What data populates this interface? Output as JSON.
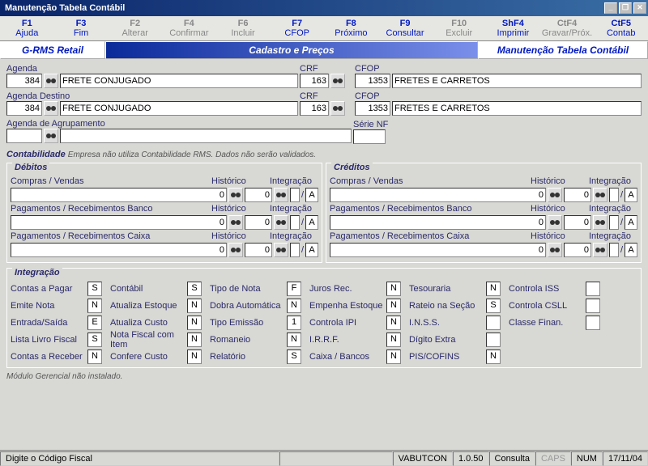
{
  "window": {
    "title": "Manutenção Tabela Contábil"
  },
  "fkeys": [
    {
      "top": "F1",
      "bot": "Ajuda",
      "disabled": false
    },
    {
      "top": "F3",
      "bot": "Fim",
      "disabled": false
    },
    {
      "top": "F2",
      "bot": "Alterar",
      "disabled": true
    },
    {
      "top": "F4",
      "bot": "Confirmar",
      "disabled": true
    },
    {
      "top": "F6",
      "bot": "Incluir",
      "disabled": true
    },
    {
      "top": "F7",
      "bot": "CFOP",
      "disabled": false
    },
    {
      "top": "F8",
      "bot": "Próximo",
      "disabled": false
    },
    {
      "top": "F9",
      "bot": "Consultar",
      "disabled": false
    },
    {
      "top": "F10",
      "bot": "Excluir",
      "disabled": true
    },
    {
      "top": "ShF4",
      "bot": "Imprimir",
      "disabled": false
    },
    {
      "top": "CtF4",
      "bot": "Gravar/Próx.",
      "disabled": true
    },
    {
      "top": "CtF5",
      "bot": "Contab",
      "disabled": false
    }
  ],
  "modebar": {
    "seg1": "G-RMS Retail",
    "seg2": "Cadastro e Preços",
    "seg3": "Manutenção Tabela Contábil"
  },
  "agenda": {
    "label": "Agenda",
    "code": "384",
    "desc": "FRETE CONJUGADO",
    "crf_label": "CRF",
    "crf": "163",
    "cfop_label": "CFOP",
    "cfop": "1353",
    "cfop_desc": "FRETES E CARRETOS"
  },
  "agenda_dest": {
    "label": "Agenda Destino",
    "code": "384",
    "desc": "FRETE CONJUGADO",
    "crf_label": "CRF",
    "crf": "163",
    "cfop_label": "CFOP",
    "cfop": "1353",
    "cfop_desc": "FRETES E CARRETOS"
  },
  "agrup": {
    "label": "Agenda de Agrupamento",
    "code": "",
    "desc": "",
    "serie_label": "Série NF",
    "serie": ""
  },
  "contabilidade": {
    "title": "Contabilidade",
    "note": "Empresa não utiliza Contabilidade RMS. Dados não serão validados."
  },
  "dc": {
    "debitos_legend": "Débitos",
    "creditos_legend": "Créditos",
    "rows": [
      {
        "lbl": "Compras / Vendas"
      },
      {
        "lbl": "Pagamentos / Recebimentos Banco"
      },
      {
        "lbl": "Pagamentos / Recebimentos Caixa"
      }
    ],
    "hist_label": "Histórico",
    "int_label": "Integração",
    "acct": "0",
    "hist": "0",
    "sep": "/",
    "int": "A"
  },
  "integr": {
    "legend": "Integração",
    "cols": [
      [
        {
          "l": "Contas a Pagar",
          "v": "S"
        },
        {
          "l": "Emite Nota",
          "v": "N"
        },
        {
          "l": "Entrada/Saída",
          "v": "E"
        },
        {
          "l": "Lista Livro Fiscal",
          "v": "S"
        },
        {
          "l": "Contas a Receber",
          "v": "N"
        }
      ],
      [
        {
          "l": "Contábil",
          "v": "S"
        },
        {
          "l": "Atualiza Estoque",
          "v": "N"
        },
        {
          "l": "Atualiza Custo",
          "v": "N"
        },
        {
          "l": "Nota Fiscal com Item",
          "v": "N"
        },
        {
          "l": "Confere Custo",
          "v": "N"
        }
      ],
      [
        {
          "l": "Tipo de Nota",
          "v": "F"
        },
        {
          "l": "Dobra Automática",
          "v": "N"
        },
        {
          "l": "Tipo Emissão",
          "v": "1"
        },
        {
          "l": "Romaneio",
          "v": "N"
        },
        {
          "l": "Relatório",
          "v": "S"
        }
      ],
      [
        {
          "l": "Juros Rec.",
          "v": "N"
        },
        {
          "l": "Empenha Estoque",
          "v": "N"
        },
        {
          "l": "Controla IPI",
          "v": "N"
        },
        {
          "l": "I.R.R.F.",
          "v": "N"
        },
        {
          "l": "Caixa / Bancos",
          "v": "N"
        }
      ],
      [
        {
          "l": "Tesouraria",
          "v": "N"
        },
        {
          "l": "Rateio na Seção",
          "v": "S"
        },
        {
          "l": "I.N.S.S.",
          "v": ""
        },
        {
          "l": "Dígito Extra",
          "v": ""
        },
        {
          "l": "PIS/COFINS",
          "v": "N"
        }
      ],
      [
        {
          "l": "Controla ISS",
          "v": ""
        },
        {
          "l": "Controla CSLL",
          "v": ""
        },
        {
          "l": "Classe Finan.",
          "v": ""
        }
      ]
    ]
  },
  "module_note": "Módulo Gerencial não instalado.",
  "status": {
    "prompt": "Digite o Código Fiscal",
    "prog": "VABUTCON",
    "ver": "1.0.50",
    "mode": "Consulta",
    "caps": "CAPS",
    "num": "NUM",
    "date": "17/11/04"
  }
}
